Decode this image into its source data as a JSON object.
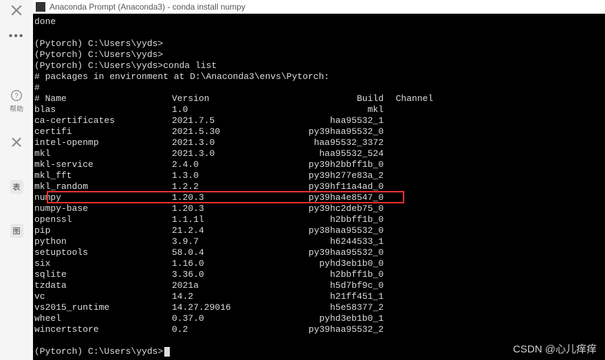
{
  "window": {
    "title": "Anaconda Prompt (Anaconda3) - conda  install numpy"
  },
  "sidebar": {
    "help_label": "帮助",
    "tag1": "表",
    "tag2": "图"
  },
  "terminal": {
    "done": "done",
    "prompt1": "(Pytorch) C:\\Users\\yyds>",
    "prompt2": "(Pytorch) C:\\Users\\yyds>",
    "prompt3_full": "(Pytorch) C:\\Users\\yyds>conda list",
    "env_line": "# packages in environment at D:\\Anaconda3\\envs\\Pytorch:",
    "hash": "#",
    "header": {
      "name": "# Name",
      "version": "Version",
      "build": "Build",
      "channel": "Channel"
    },
    "packages": [
      {
        "name": "blas",
        "version": "1.0",
        "build": "mkl",
        "channel": ""
      },
      {
        "name": "ca-certificates",
        "version": "2021.7.5",
        "build": "haa95532_1",
        "channel": ""
      },
      {
        "name": "certifi",
        "version": "2021.5.30",
        "build": "py39haa95532_0",
        "channel": ""
      },
      {
        "name": "intel-openmp",
        "version": "2021.3.0",
        "build": "haa95532_3372",
        "channel": ""
      },
      {
        "name": "mkl",
        "version": "2021.3.0",
        "build": "haa95532_524",
        "channel": ""
      },
      {
        "name": "mkl-service",
        "version": "2.4.0",
        "build": "py39h2bbff1b_0",
        "channel": ""
      },
      {
        "name": "mkl_fft",
        "version": "1.3.0",
        "build": "py39h277e83a_2",
        "channel": ""
      },
      {
        "name": "mkl_random",
        "version": "1.2.2",
        "build": "py39hf11a4ad_0",
        "channel": ""
      },
      {
        "name": "numpy",
        "version": "1.20.3",
        "build": "py39ha4e8547_0",
        "channel": ""
      },
      {
        "name": "numpy-base",
        "version": "1.20.3",
        "build": "py39hc2deb75_0",
        "channel": ""
      },
      {
        "name": "openssl",
        "version": "1.1.1l",
        "build": "h2bbff1b_0",
        "channel": ""
      },
      {
        "name": "pip",
        "version": "21.2.4",
        "build": "py38haa95532_0",
        "channel": ""
      },
      {
        "name": "python",
        "version": "3.9.7",
        "build": "h6244533_1",
        "channel": ""
      },
      {
        "name": "setuptools",
        "version": "58.0.4",
        "build": "py39haa95532_0",
        "channel": ""
      },
      {
        "name": "six",
        "version": "1.16.0",
        "build": "pyhd3eb1b0_0",
        "channel": ""
      },
      {
        "name": "sqlite",
        "version": "3.36.0",
        "build": "h2bbff1b_0",
        "channel": ""
      },
      {
        "name": "tzdata",
        "version": "2021a",
        "build": "h5d7bf9c_0",
        "channel": ""
      },
      {
        "name": "vc",
        "version": "14.2",
        "build": "h21ff451_1",
        "channel": ""
      },
      {
        "name": "vs2015_runtime",
        "version": "14.27.29016",
        "build": "h5e58377_2",
        "channel": ""
      },
      {
        "name": "wheel",
        "version": "0.37.0",
        "build": "pyhd3eb1b0_1",
        "channel": ""
      },
      {
        "name": "wincertstore",
        "version": "0.2",
        "build": "py39haa95532_2",
        "channel": ""
      }
    ],
    "prompt_end": "(Pytorch) C:\\Users\\yyds>",
    "highlighted_package": "numpy"
  },
  "watermark": "CSDN @心儿痒痒"
}
